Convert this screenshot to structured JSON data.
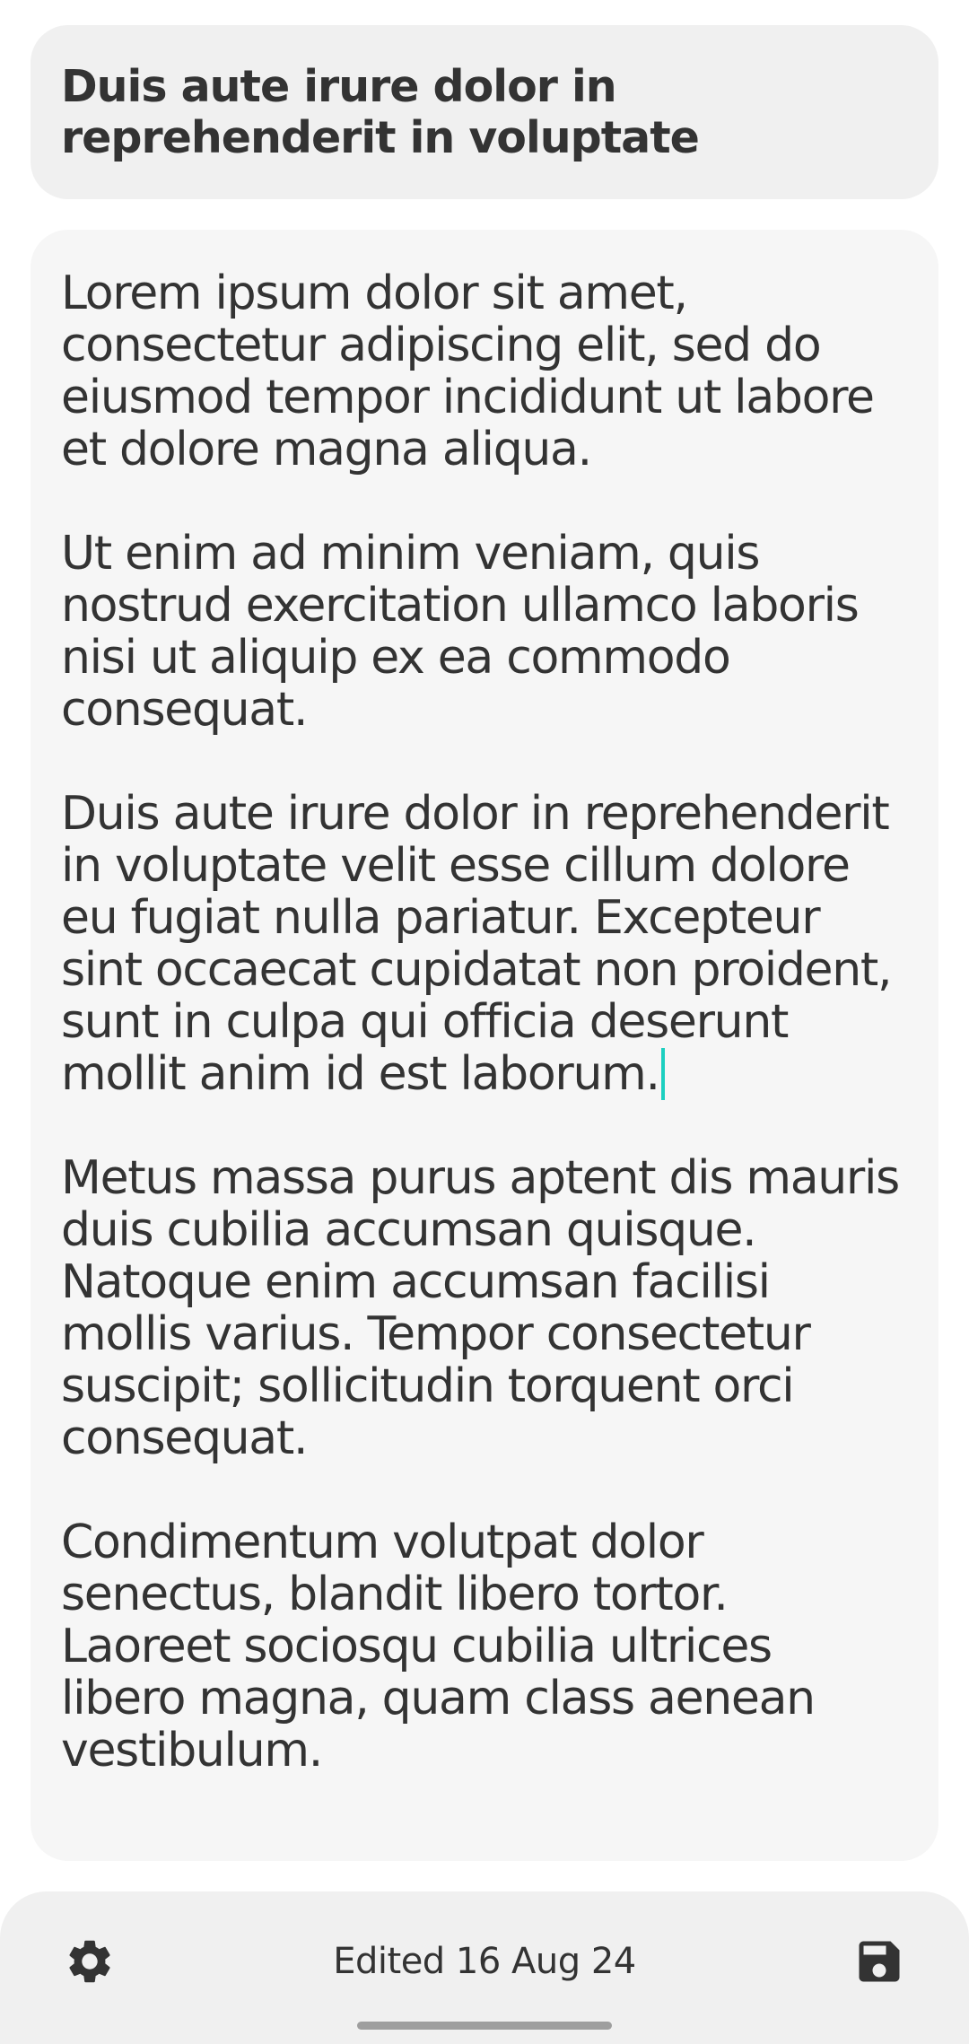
{
  "note": {
    "title": "Duis aute irure dolor in reprehenderit in voluptate",
    "paragraphs": [
      "Lorem ipsum dolor sit amet, consectetur adipiscing elit, sed do eiusmod tempor incididunt ut labore et dolore magna aliqua.",
      "Ut enim ad minim veniam, quis nostrud exercitation ullamco laboris nisi ut aliquip ex ea commodo consequat.",
      "Duis aute irure dolor in reprehenderit in voluptate velit esse cillum dolore eu fugiat nulla pariatur. Excepteur sint occaecat cupidatat non proident, sunt in culpa qui officia deserunt mollit anim id est laborum.",
      "Metus massa purus aptent dis mauris duis cubilia accumsan quisque. Natoque enim accumsan facilisi mollis varius. Tempor consectetur suscipit; sollicitudin torquent orci consequat.",
      "Condimentum volutpat dolor senectus, blandit libero tortor. Laoreet sociosqu cubilia ultrices libero magna, quam class aenean vestibulum."
    ]
  },
  "bottom_bar": {
    "edited_label": "Edited 16 Aug 24",
    "settings_icon": "gear-icon",
    "save_icon": "save-icon"
  },
  "colors": {
    "cursor": "#1ccfc0",
    "text": "#333333",
    "title_card_bg": "#f0f0f0",
    "body_card_bg": "#f6f6f6"
  }
}
